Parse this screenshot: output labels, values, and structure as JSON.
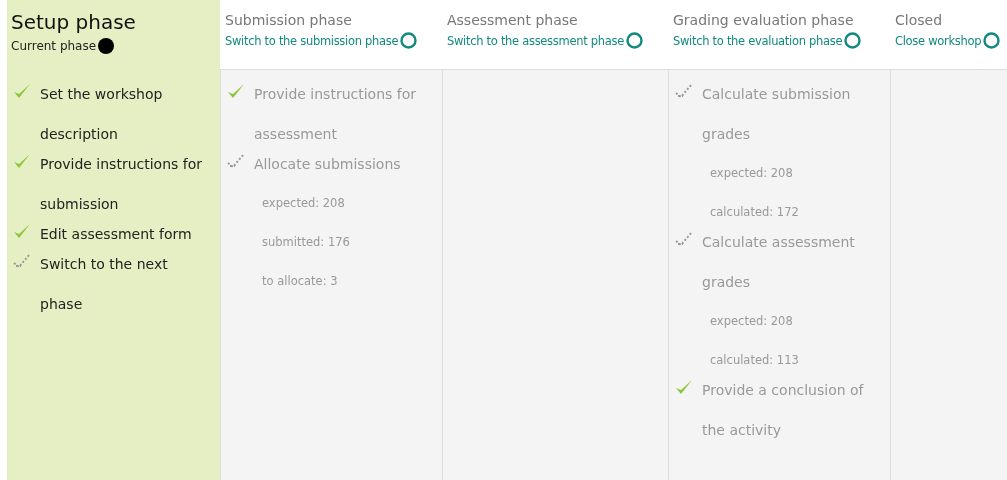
{
  "phases": [
    {
      "title": "Setup phase",
      "current": true,
      "status": "Current phase",
      "tasks": [
        {
          "label": "Set the workshop description",
          "done": true
        },
        {
          "label": "Provide instructions for submission",
          "done": true
        },
        {
          "label": "Edit assessment form",
          "done": true
        },
        {
          "label": "Switch to the next phase",
          "done": false
        }
      ]
    },
    {
      "title": "Submission phase",
      "current": false,
      "action": "Switch to the submission phase",
      "tasks": [
        {
          "label": "Provide instructions for assessment",
          "done": true
        },
        {
          "label": "Allocate submissions",
          "done": false,
          "info": [
            "expected: 208",
            "submitted: 176",
            "to allocate: 3"
          ]
        }
      ]
    },
    {
      "title": "Assessment phase",
      "current": false,
      "action": "Switch to the assessment phase"
    },
    {
      "title": "Grading evaluation phase",
      "current": false,
      "action": "Switch to the evaluation phase",
      "tasks": [
        {
          "label": "Calculate submission grades",
          "done": false,
          "info": [
            "expected: 208",
            "calculated: 172"
          ]
        },
        {
          "label": "Calculate assessment grades",
          "done": false,
          "info": [
            "expected: 208",
            "calculated: 113"
          ]
        },
        {
          "label": "Provide a conclusion of the activity",
          "done": true
        }
      ]
    },
    {
      "title": "Closed",
      "current": false,
      "action": "Close workshop"
    }
  ]
}
